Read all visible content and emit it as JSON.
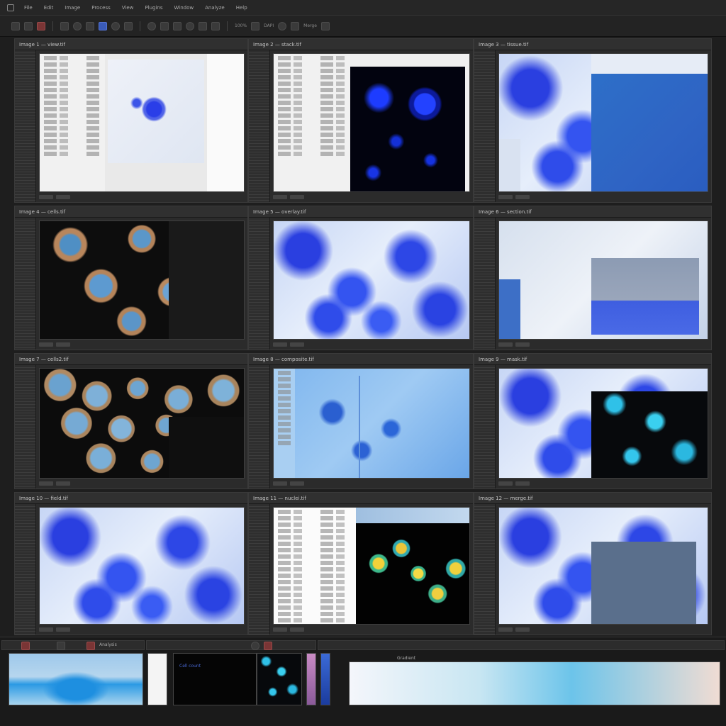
{
  "menubar": {
    "items": [
      {
        "label": "File"
      },
      {
        "label": "Edit"
      },
      {
        "label": "Image"
      },
      {
        "label": "Process"
      },
      {
        "label": "View"
      },
      {
        "label": "Plugins"
      },
      {
        "label": "Window"
      },
      {
        "label": "Analyze"
      },
      {
        "label": "Help"
      }
    ]
  },
  "toolbar": {
    "zoom_label": "100%",
    "channel_label": "DAPI",
    "mode_label": "Merge"
  },
  "panes": [
    {
      "title": "Image 1 — view.tif"
    },
    {
      "title": "Image 2 — stack.tif"
    },
    {
      "title": "Image 3 — tissue.tif"
    },
    {
      "title": "Image 4 — cells.tif"
    },
    {
      "title": "Image 5 — overlay.tif"
    },
    {
      "title": "Image 6 — section.tif"
    },
    {
      "title": "Image 7 — cells2.tif"
    },
    {
      "title": "Image 8 — composite.tif"
    },
    {
      "title": "Image 9 — mask.tif"
    },
    {
      "title": "Image 10 — field.tif"
    },
    {
      "title": "Image 11 — nuclei.tif"
    },
    {
      "title": "Image 12 — merge.tif"
    }
  ],
  "strip": {
    "label_a": "Analysis",
    "label_b": "Cell count",
    "label_c": "Gradient"
  },
  "colors": {
    "accent": "#3a5bb8",
    "panel_bg": "#2b2b2b",
    "window_bg": "#1e1e1e"
  }
}
